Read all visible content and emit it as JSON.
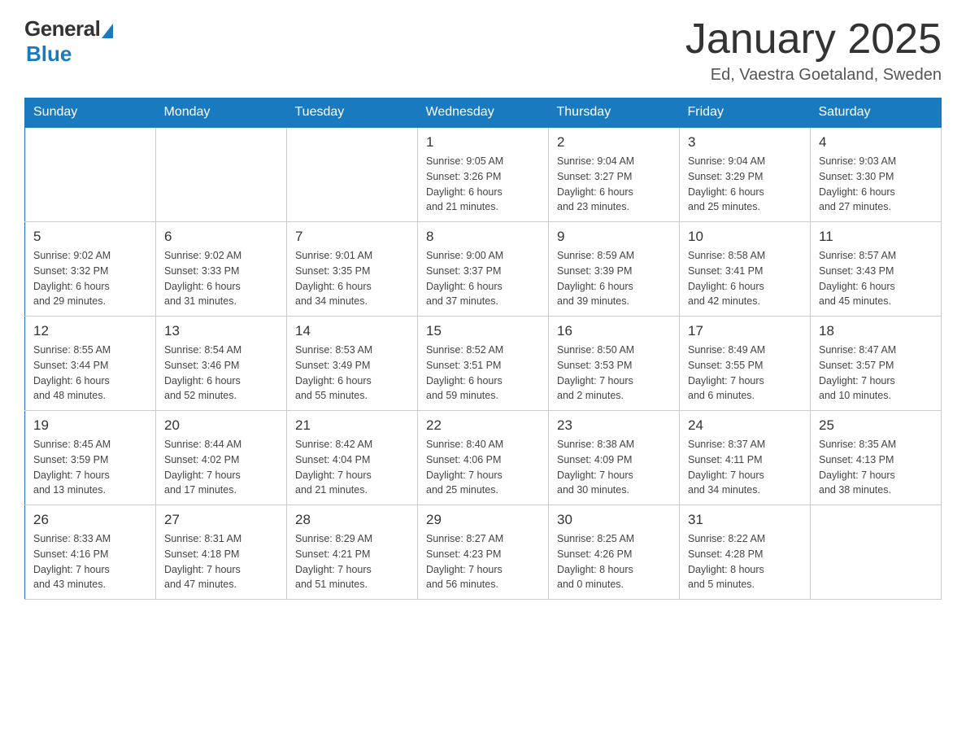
{
  "header": {
    "logo_general": "General",
    "logo_blue": "Blue",
    "title": "January 2025",
    "subtitle": "Ed, Vaestra Goetaland, Sweden"
  },
  "days_of_week": [
    "Sunday",
    "Monday",
    "Tuesday",
    "Wednesday",
    "Thursday",
    "Friday",
    "Saturday"
  ],
  "weeks": [
    [
      {
        "day": "",
        "info": ""
      },
      {
        "day": "",
        "info": ""
      },
      {
        "day": "",
        "info": ""
      },
      {
        "day": "1",
        "info": "Sunrise: 9:05 AM\nSunset: 3:26 PM\nDaylight: 6 hours\nand 21 minutes."
      },
      {
        "day": "2",
        "info": "Sunrise: 9:04 AM\nSunset: 3:27 PM\nDaylight: 6 hours\nand 23 minutes."
      },
      {
        "day": "3",
        "info": "Sunrise: 9:04 AM\nSunset: 3:29 PM\nDaylight: 6 hours\nand 25 minutes."
      },
      {
        "day": "4",
        "info": "Sunrise: 9:03 AM\nSunset: 3:30 PM\nDaylight: 6 hours\nand 27 minutes."
      }
    ],
    [
      {
        "day": "5",
        "info": "Sunrise: 9:02 AM\nSunset: 3:32 PM\nDaylight: 6 hours\nand 29 minutes."
      },
      {
        "day": "6",
        "info": "Sunrise: 9:02 AM\nSunset: 3:33 PM\nDaylight: 6 hours\nand 31 minutes."
      },
      {
        "day": "7",
        "info": "Sunrise: 9:01 AM\nSunset: 3:35 PM\nDaylight: 6 hours\nand 34 minutes."
      },
      {
        "day": "8",
        "info": "Sunrise: 9:00 AM\nSunset: 3:37 PM\nDaylight: 6 hours\nand 37 minutes."
      },
      {
        "day": "9",
        "info": "Sunrise: 8:59 AM\nSunset: 3:39 PM\nDaylight: 6 hours\nand 39 minutes."
      },
      {
        "day": "10",
        "info": "Sunrise: 8:58 AM\nSunset: 3:41 PM\nDaylight: 6 hours\nand 42 minutes."
      },
      {
        "day": "11",
        "info": "Sunrise: 8:57 AM\nSunset: 3:43 PM\nDaylight: 6 hours\nand 45 minutes."
      }
    ],
    [
      {
        "day": "12",
        "info": "Sunrise: 8:55 AM\nSunset: 3:44 PM\nDaylight: 6 hours\nand 48 minutes."
      },
      {
        "day": "13",
        "info": "Sunrise: 8:54 AM\nSunset: 3:46 PM\nDaylight: 6 hours\nand 52 minutes."
      },
      {
        "day": "14",
        "info": "Sunrise: 8:53 AM\nSunset: 3:49 PM\nDaylight: 6 hours\nand 55 minutes."
      },
      {
        "day": "15",
        "info": "Sunrise: 8:52 AM\nSunset: 3:51 PM\nDaylight: 6 hours\nand 59 minutes."
      },
      {
        "day": "16",
        "info": "Sunrise: 8:50 AM\nSunset: 3:53 PM\nDaylight: 7 hours\nand 2 minutes."
      },
      {
        "day": "17",
        "info": "Sunrise: 8:49 AM\nSunset: 3:55 PM\nDaylight: 7 hours\nand 6 minutes."
      },
      {
        "day": "18",
        "info": "Sunrise: 8:47 AM\nSunset: 3:57 PM\nDaylight: 7 hours\nand 10 minutes."
      }
    ],
    [
      {
        "day": "19",
        "info": "Sunrise: 8:45 AM\nSunset: 3:59 PM\nDaylight: 7 hours\nand 13 minutes."
      },
      {
        "day": "20",
        "info": "Sunrise: 8:44 AM\nSunset: 4:02 PM\nDaylight: 7 hours\nand 17 minutes."
      },
      {
        "day": "21",
        "info": "Sunrise: 8:42 AM\nSunset: 4:04 PM\nDaylight: 7 hours\nand 21 minutes."
      },
      {
        "day": "22",
        "info": "Sunrise: 8:40 AM\nSunset: 4:06 PM\nDaylight: 7 hours\nand 25 minutes."
      },
      {
        "day": "23",
        "info": "Sunrise: 8:38 AM\nSunset: 4:09 PM\nDaylight: 7 hours\nand 30 minutes."
      },
      {
        "day": "24",
        "info": "Sunrise: 8:37 AM\nSunset: 4:11 PM\nDaylight: 7 hours\nand 34 minutes."
      },
      {
        "day": "25",
        "info": "Sunrise: 8:35 AM\nSunset: 4:13 PM\nDaylight: 7 hours\nand 38 minutes."
      }
    ],
    [
      {
        "day": "26",
        "info": "Sunrise: 8:33 AM\nSunset: 4:16 PM\nDaylight: 7 hours\nand 43 minutes."
      },
      {
        "day": "27",
        "info": "Sunrise: 8:31 AM\nSunset: 4:18 PM\nDaylight: 7 hours\nand 47 minutes."
      },
      {
        "day": "28",
        "info": "Sunrise: 8:29 AM\nSunset: 4:21 PM\nDaylight: 7 hours\nand 51 minutes."
      },
      {
        "day": "29",
        "info": "Sunrise: 8:27 AM\nSunset: 4:23 PM\nDaylight: 7 hours\nand 56 minutes."
      },
      {
        "day": "30",
        "info": "Sunrise: 8:25 AM\nSunset: 4:26 PM\nDaylight: 8 hours\nand 0 minutes."
      },
      {
        "day": "31",
        "info": "Sunrise: 8:22 AM\nSunset: 4:28 PM\nDaylight: 8 hours\nand 5 minutes."
      },
      {
        "day": "",
        "info": ""
      }
    ]
  ]
}
